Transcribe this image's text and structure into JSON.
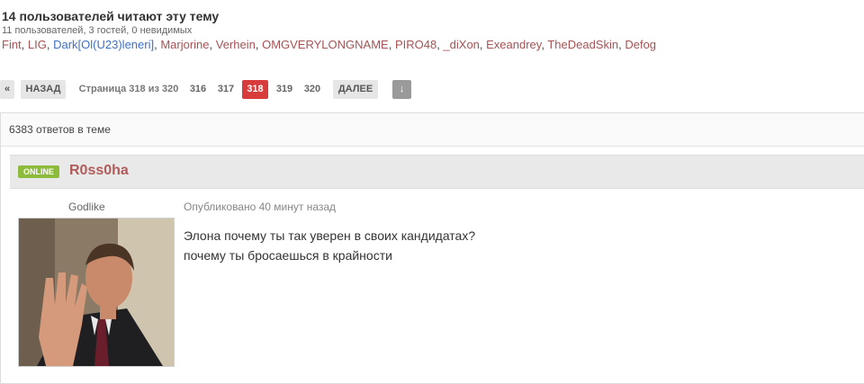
{
  "viewers": {
    "title": "14 пользователей читают эту тему",
    "subtitle": "11 пользователей, 3 гостей, 0 невидимых",
    "users": [
      {
        "name": "Fint",
        "sep": ", "
      },
      {
        "name": "LIG",
        "sep": ", "
      },
      {
        "name": "Dark[Ol(U23)leneri]",
        "sep": ", "
      },
      {
        "name": "Marjorine",
        "sep": ", "
      },
      {
        "name": "Verhein",
        "sep": ", "
      },
      {
        "name": "OMGVERYLONGNAME",
        "sep": ", "
      },
      {
        "name": "PIRO48",
        "sep": ", "
      },
      {
        "name": "_diXon",
        "sep": ", "
      },
      {
        "name": "Exeandrey",
        "sep": ", "
      },
      {
        "name": "TheDeadSkin",
        "sep": ", "
      },
      {
        "name": "Defog",
        "sep": ""
      }
    ],
    "colors": {
      "default": "#a55355",
      "highlight": "#3f70c9"
    }
  },
  "pagination": {
    "first_label": "«",
    "prev_label": "НАЗАД",
    "page_info": "Страница 318 из 320",
    "pages": [
      "316",
      "317",
      "318",
      "319",
      "320"
    ],
    "current": "318",
    "next_label": "ДАЛЕЕ",
    "jump_icon": "arrow-down-icon",
    "jump_glyph": "↓"
  },
  "topic": {
    "reply_count": "6383 ответов в теме"
  },
  "post": {
    "status": "ONLINE",
    "author": "R0ss0ha",
    "rank": "Godlike",
    "posted": "Опубликовано 40 минут назад",
    "lines": [
      "Элона почему ты так уверен в своих кандидатах?",
      "почему ты бросаешься в крайности"
    ]
  },
  "colors": {
    "accent": "#d73b3b",
    "online": "#8dbb3b",
    "author": "#b25b5b"
  }
}
